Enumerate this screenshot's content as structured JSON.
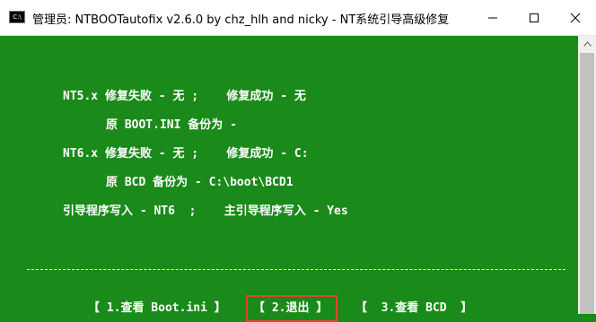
{
  "window": {
    "icon_label": "C:\\",
    "title": "管理员:  NTBOOTautofix v2.6.0 by chz_hlh and nicky - NT系统引导高级修复"
  },
  "console": {
    "lines": [
      "NT5.x 修复失败 - 无 ;    修复成功 - 无",
      "原 BOOT.INI 备份为 -",
      "NT6.x 修复失败 - 无 ;    修复成功 - C:",
      "原 BCD 备份为 - C:\\boot\\BCD1",
      "引导程序写入 - NT6  ;    主引导程序写入 - Yes"
    ],
    "separator": "------------------------------------------------------------------------------------------",
    "menu": {
      "item1": "【 1.查看 Boot.ini 】",
      "item2": "【 2.退出 】",
      "item3": "【  3.查看 BCD  】"
    }
  },
  "colors": {
    "console_bg": "#1a8a1a",
    "console_fg": "#ffffff",
    "selection_border": "#e0452c"
  }
}
